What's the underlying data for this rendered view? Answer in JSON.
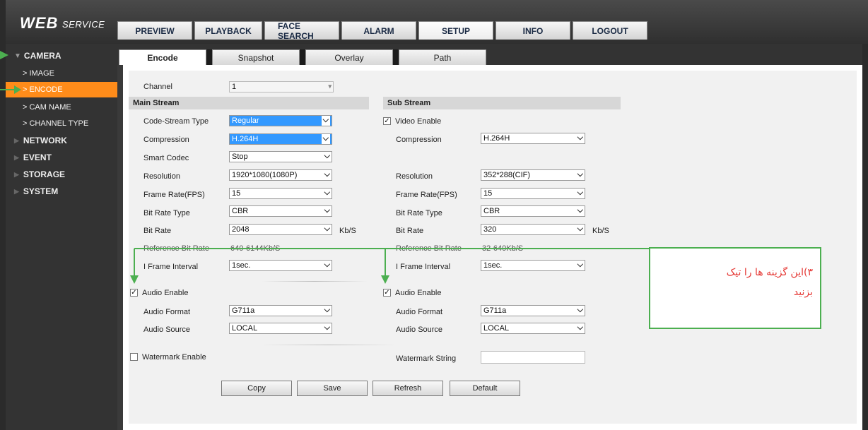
{
  "logo": {
    "main": "WEB",
    "sub": "SERVICE"
  },
  "topnav": [
    "PREVIEW",
    "PLAYBACK",
    "FACE SEARCH",
    "ALARM",
    "SETUP",
    "INFO",
    "LOGOUT"
  ],
  "sidebar": {
    "camera": "CAMERA",
    "sub_items": [
      "> IMAGE",
      "> ENCODE",
      "> CAM NAME",
      "> CHANNEL TYPE"
    ],
    "sections": [
      "NETWORK",
      "EVENT",
      "STORAGE",
      "SYSTEM"
    ]
  },
  "subtabs": [
    "Encode",
    "Snapshot",
    "Overlay",
    "Path"
  ],
  "channel": {
    "label": "Channel",
    "value": "1"
  },
  "main_stream": {
    "header": "Main Stream",
    "code_stream_type": {
      "label": "Code-Stream Type",
      "value": "Regular"
    },
    "compression": {
      "label": "Compression",
      "value": "H.264H"
    },
    "smart_codec": {
      "label": "Smart Codec",
      "value": "Stop"
    },
    "resolution": {
      "label": "Resolution",
      "value": "1920*1080(1080P)"
    },
    "frame_rate": {
      "label": "Frame Rate(FPS)",
      "value": "15"
    },
    "bit_rate_type": {
      "label": "Bit Rate Type",
      "value": "CBR"
    },
    "bit_rate": {
      "label": "Bit Rate",
      "value": "2048",
      "unit": "Kb/S"
    },
    "reference_bit_rate": {
      "label": "Reference Bit Rate",
      "value": "640-6144Kb/S"
    },
    "i_frame_interval": {
      "label": "I Frame Interval",
      "value": "1sec."
    },
    "audio_enable": {
      "label": "Audio Enable",
      "checked": "✓"
    },
    "audio_format": {
      "label": "Audio Format",
      "value": "G711a"
    },
    "audio_source": {
      "label": "Audio Source",
      "value": "LOCAL"
    }
  },
  "sub_stream": {
    "header": "Sub Stream",
    "video_enable": {
      "label": "Video Enable",
      "checked": "✓"
    },
    "compression": {
      "label": "Compression",
      "value": "H.264H"
    },
    "resolution": {
      "label": "Resolution",
      "value": "352*288(CIF)"
    },
    "frame_rate": {
      "label": "Frame Rate(FPS)",
      "value": "15"
    },
    "bit_rate_type": {
      "label": "Bit Rate Type",
      "value": "CBR"
    },
    "bit_rate": {
      "label": "Bit Rate",
      "value": "320",
      "unit": "Kb/S"
    },
    "reference_bit_rate": {
      "label": "Reference Bit Rate",
      "value": "32-640Kb/S"
    },
    "i_frame_interval": {
      "label": "I Frame Interval",
      "value": "1sec."
    },
    "audio_enable": {
      "label": "Audio Enable",
      "checked": "✓"
    },
    "audio_format": {
      "label": "Audio Format",
      "value": "G711a"
    },
    "audio_source": {
      "label": "Audio Source",
      "value": "LOCAL"
    }
  },
  "watermark": {
    "enable_label": "Watermark Enable",
    "string_label": "Watermark String",
    "string_value": ""
  },
  "buttons": {
    "copy": "Copy",
    "save": "Save",
    "refresh": "Refresh",
    "default": "Default"
  },
  "annotation": {
    "line1": "۳)این گزینه ها را تیک",
    "line2": "بزنید"
  },
  "colors": {
    "accent": "#ff8c1a",
    "annotation_green": "#4caf50",
    "annotation_text": "#e53935",
    "selection_blue": "#3399ff"
  }
}
